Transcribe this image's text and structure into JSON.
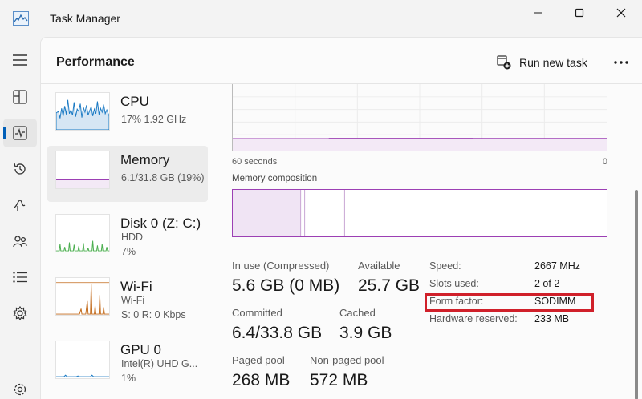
{
  "window": {
    "title": "Task Manager"
  },
  "header": {
    "page_title": "Performance",
    "run_new_task_label": "Run new task"
  },
  "nav": {
    "items": [
      {
        "icon": "hamburger-icon"
      },
      {
        "icon": "processes-icon"
      },
      {
        "icon": "performance-icon",
        "active": true
      },
      {
        "icon": "app-history-icon"
      },
      {
        "icon": "startup-apps-icon"
      },
      {
        "icon": "users-icon"
      },
      {
        "icon": "details-icon"
      },
      {
        "icon": "services-icon"
      },
      {
        "icon": "settings-icon"
      }
    ]
  },
  "devices": [
    {
      "name": "CPU",
      "sub1": "17%  1.92 GHz",
      "color": "#1a7ac4"
    },
    {
      "name": "Memory",
      "sub1": "6.1/31.8 GB (19%)",
      "color": "#9c3fb4",
      "selected": true
    },
    {
      "name": "Disk 0 (Z: C:)",
      "sub1": "HDD",
      "sub2": "7%",
      "color": "#4caf50"
    },
    {
      "name": "Wi-Fi",
      "sub1": "Wi-Fi",
      "sub2": "S: 0  R: 0 Kbps",
      "color": "#c26a1b"
    },
    {
      "name": "GPU 0",
      "sub1": "Intel(R) UHD G...",
      "sub2": "1%",
      "color": "#1a7ac4"
    }
  ],
  "detail": {
    "time_scale_left": "60 seconds",
    "time_scale_right": "0",
    "memory_composition_label": "Memory composition",
    "in_use_label": "In use (Compressed)",
    "in_use_value": "5.6 GB (0 MB)",
    "available_label": "Available",
    "available_value": "25.7 GB",
    "committed_label": "Committed",
    "committed_value": "6.4/33.8 GB",
    "cached_label": "Cached",
    "cached_value": "3.9 GB",
    "paged_pool_label": "Paged pool",
    "paged_pool_value": "268 MB",
    "non_paged_pool_label": "Non-paged pool",
    "non_paged_pool_value": "572 MB",
    "properties": [
      {
        "label": "Speed:",
        "value": "2667 MHz"
      },
      {
        "label": "Slots used:",
        "value": "2 of 2"
      },
      {
        "label": "Form factor:",
        "value": "SODIMM"
      },
      {
        "label": "Hardware reserved:",
        "value": "233 MB"
      }
    ]
  },
  "colors": {
    "memory_accent": "#9c3fb4",
    "highlight": "#d0202a",
    "nav_active": "#005fb8"
  }
}
